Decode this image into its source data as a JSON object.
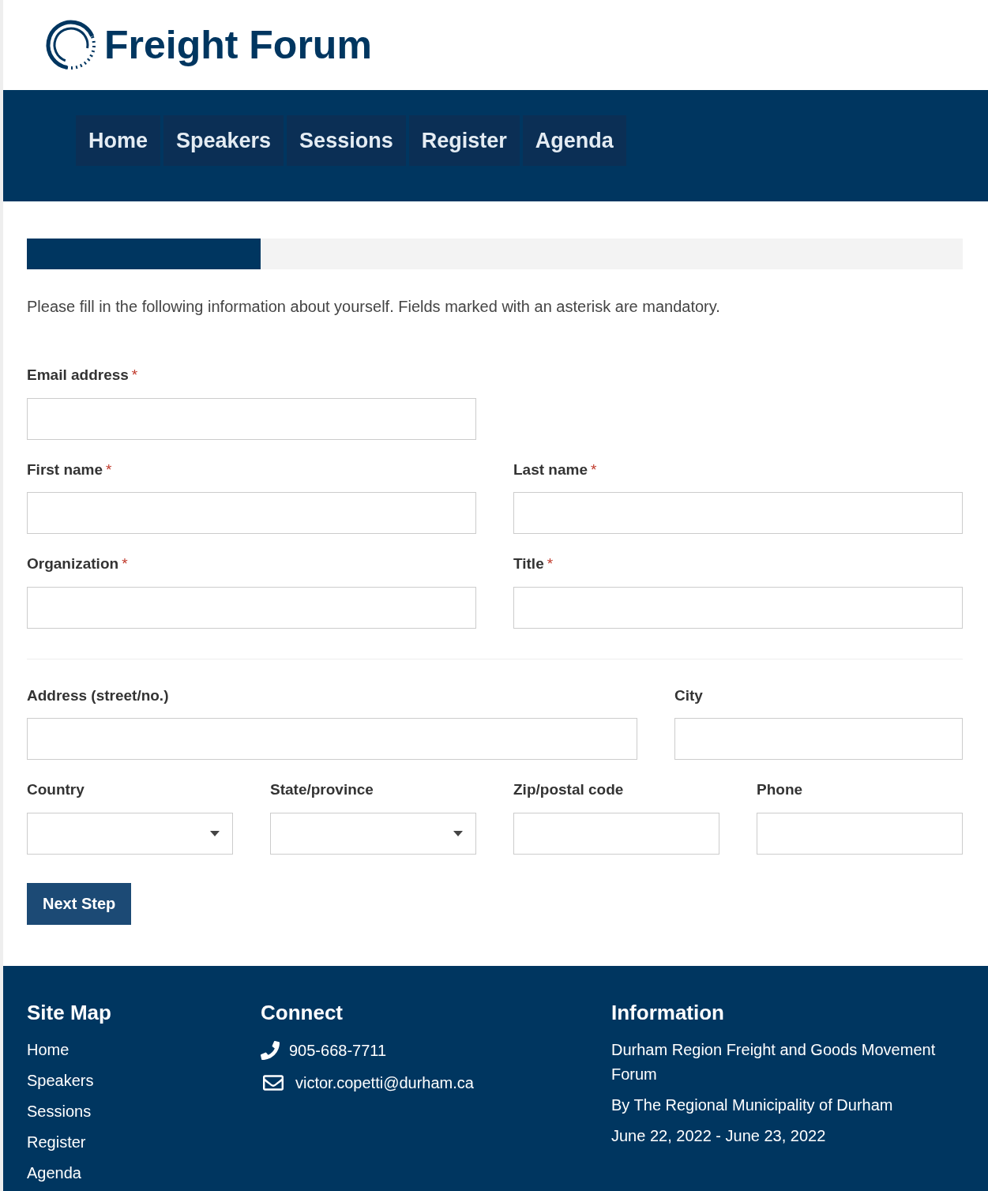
{
  "logo": {
    "text": "Freight Forum"
  },
  "nav": [
    {
      "label": "Home"
    },
    {
      "label": "Speakers"
    },
    {
      "label": "Sessions"
    },
    {
      "label": "Register"
    },
    {
      "label": "Agenda"
    }
  ],
  "progress": {
    "level": 0.25
  },
  "intro": "Please fill in the following information about yourself. Fields marked with an asterisk are mandatory.",
  "required_mark": "*",
  "sections": [
    {
      "rows": [
        [
          {
            "label": "Email address",
            "required": true,
            "kind": "text"
          }
        ],
        [
          {
            "label": "First name",
            "required": true,
            "kind": "text"
          },
          {
            "label": "Last name",
            "required": true,
            "kind": "text"
          }
        ],
        [
          {
            "label": "Organization",
            "required": true,
            "kind": "text"
          },
          {
            "label": "Title",
            "required": true,
            "kind": "text"
          }
        ]
      ]
    },
    {
      "rows": [
        [
          {
            "label": "Address (street/no.)",
            "required": false,
            "kind": "text"
          },
          {
            "label": "City",
            "required": false,
            "kind": "text"
          }
        ],
        [
          {
            "label": "Country",
            "required": false,
            "kind": "select"
          },
          {
            "label": "State/province",
            "required": false,
            "kind": "select"
          },
          {
            "label": "Zip/postal code",
            "required": false,
            "kind": "text"
          },
          {
            "label": "Phone",
            "required": false,
            "kind": "text"
          }
        ]
      ]
    }
  ],
  "submit": "Next Step",
  "footer": {
    "site_map": {
      "title": "Site Map",
      "links": [
        "Home",
        "Speakers",
        "Sessions",
        "Register",
        "Agenda"
      ]
    },
    "connect": {
      "title": "Connect",
      "items": [
        {
          "kind": "phone",
          "text": "905-668-7711"
        },
        {
          "kind": "email",
          "text": "victor.copetti@durham.ca"
        }
      ]
    },
    "information": {
      "title": "Information",
      "lines": [
        "Durham Region Freight and Goods Movement Forum",
        "By The Regional Municipality of Durham",
        "June 22, 2022 - June 23, 2022"
      ]
    }
  }
}
